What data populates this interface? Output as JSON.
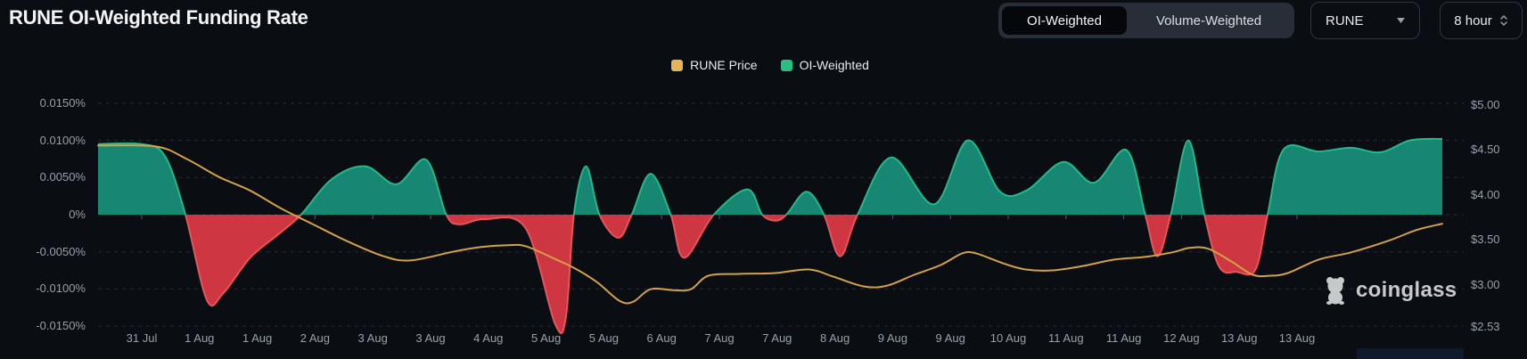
{
  "header": {
    "title": "RUNE OI-Weighted Funding Rate",
    "weighting_toggle": {
      "options": [
        "OI-Weighted",
        "Volume-Weighted"
      ],
      "active": "OI-Weighted"
    },
    "symbol_select": {
      "value": "RUNE"
    },
    "interval_select": {
      "value": "8 hour"
    }
  },
  "legend": [
    {
      "label": "RUNE Price",
      "color": "#E5B455"
    },
    {
      "label": "OI-Weighted",
      "color": "#2CBD84"
    }
  ],
  "watermark": {
    "text": "coinglass"
  },
  "colors": {
    "background": "#0A0D12",
    "grid": "#272C33",
    "axis_text": "#99A0A7",
    "funding_positive_fill": "#178672",
    "funding_positive_edge": "#25B98A",
    "funding_negative_fill": "#CE3642",
    "funding_negative_edge": "#E8545C",
    "price_line": "#D2A148"
  },
  "chart_data": {
    "type": "area",
    "title": "RUNE OI-Weighted Funding Rate",
    "x_unit": "percent_of_plot_width",
    "x_axis": {
      "labels": [
        "31 Jul",
        "1 Aug",
        "1 Aug",
        "2 Aug",
        "3 Aug",
        "3 Aug",
        "4 Aug",
        "5 Aug",
        "5 Aug",
        "6 Aug",
        "7 Aug",
        "7 Aug",
        "8 Aug",
        "9 Aug",
        "9 Aug",
        "10 Aug",
        "11 Aug",
        "11 Aug",
        "12 Aug",
        "13 Aug",
        "13 Aug"
      ]
    },
    "left_axis": {
      "unit": "%",
      "tick_labels": [
        "0.0150%",
        "0.0100%",
        "0.0050%",
        "0%",
        "-0.0050%",
        "-0.0100%",
        "-0.0150%"
      ],
      "tick_values": [
        0.015,
        0.01,
        0.005,
        0,
        -0.005,
        -0.01,
        -0.015
      ],
      "range": [
        -0.0175,
        0.0175
      ]
    },
    "right_axis": {
      "unit": "USD",
      "tick_labels": [
        "$5.00",
        "$4.50",
        "$4.00",
        "$3.50",
        "$3.00",
        "$2.53"
      ],
      "tick_values": [
        5.0,
        4.5,
        4.0,
        3.5,
        3.0,
        2.53
      ],
      "range": [
        2.53,
        5.0
      ]
    },
    "grid": {
      "style": "dashed",
      "lines": "left_axis_ticks"
    },
    "legend_position": "top-center",
    "series": [
      {
        "name": "OI-Weighted",
        "axis": "left",
        "unit": "%",
        "style": "smoothed-area-positive-negative",
        "points": [
          [
            0,
            0.0095
          ],
          [
            3.3,
            0.0095
          ],
          [
            5,
            0.0078
          ],
          [
            6.5,
            0
          ],
          [
            8.1,
            -0.0115
          ],
          [
            9.3,
            -0.0106
          ],
          [
            11.3,
            -0.0058
          ],
          [
            13.3,
            -0.0028
          ],
          [
            15.1,
            0
          ],
          [
            17.4,
            0.0048
          ],
          [
            19.9,
            0.0065
          ],
          [
            22.2,
            0.0041
          ],
          [
            24.4,
            0.0074
          ],
          [
            25.9,
            0
          ],
          [
            26.9,
            -0.0013
          ],
          [
            28.8,
            -0.0006
          ],
          [
            31.8,
            -0.0018
          ],
          [
            34,
            -0.0147
          ],
          [
            34.8,
            -0.0138
          ],
          [
            35.4,
            0
          ],
          [
            36.3,
            0.0065
          ],
          [
            37.3,
            0
          ],
          [
            38.7,
            -0.0031
          ],
          [
            39.7,
            0
          ],
          [
            41.1,
            0.0055
          ],
          [
            42.6,
            0
          ],
          [
            43.6,
            -0.0058
          ],
          [
            45.8,
            0
          ],
          [
            48.3,
            0.0034
          ],
          [
            49.4,
            0
          ],
          [
            50.4,
            -0.0008
          ],
          [
            51.2,
            0
          ],
          [
            52.7,
            0.0031
          ],
          [
            54,
            0
          ],
          [
            55.2,
            -0.0056
          ],
          [
            56.5,
            0
          ],
          [
            59,
            0.0077
          ],
          [
            62.2,
            0.0014
          ],
          [
            64.7,
            0.01
          ],
          [
            67.1,
            0.0031
          ],
          [
            69.1,
            0.0033
          ],
          [
            71.8,
            0.0071
          ],
          [
            74.1,
            0.0043
          ],
          [
            76.5,
            0.0087
          ],
          [
            77.9,
            0
          ],
          [
            78.8,
            -0.0056
          ],
          [
            79.8,
            0
          ],
          [
            81.1,
            0.01
          ],
          [
            82.3,
            0
          ],
          [
            83.4,
            -0.007
          ],
          [
            84.7,
            -0.0077
          ],
          [
            86.1,
            -0.0074
          ],
          [
            87,
            0
          ],
          [
            88.2,
            0.0088
          ],
          [
            90.8,
            0.0085
          ],
          [
            93.2,
            0.009
          ],
          [
            95.4,
            0.0084
          ],
          [
            97.6,
            0.01
          ],
          [
            100,
            0.0102
          ]
        ]
      },
      {
        "name": "RUNE Price",
        "axis": "right",
        "unit": "USD",
        "style": "line",
        "points": [
          [
            0,
            4.55
          ],
          [
            4.3,
            4.54
          ],
          [
            6.6,
            4.4
          ],
          [
            9,
            4.2
          ],
          [
            11.3,
            4.05
          ],
          [
            13.6,
            3.85
          ],
          [
            15.9,
            3.68
          ],
          [
            18.6,
            3.48
          ],
          [
            21.2,
            3.32
          ],
          [
            23.2,
            3.27
          ],
          [
            26.5,
            3.37
          ],
          [
            28.5,
            3.42
          ],
          [
            30.5,
            3.44
          ],
          [
            31.8,
            3.43
          ],
          [
            33.8,
            3.3
          ],
          [
            35.5,
            3.18
          ],
          [
            37.1,
            3.03
          ],
          [
            38.8,
            2.82
          ],
          [
            39.8,
            2.81
          ],
          [
            41.1,
            2.95
          ],
          [
            42.8,
            2.94
          ],
          [
            44.1,
            2.95
          ],
          [
            45.4,
            3.1
          ],
          [
            47.7,
            3.12
          ],
          [
            50.4,
            3.13
          ],
          [
            52.9,
            3.17
          ],
          [
            54.7,
            3.09
          ],
          [
            57,
            2.98
          ],
          [
            58.7,
            2.99
          ],
          [
            60.7,
            3.11
          ],
          [
            62.7,
            3.22
          ],
          [
            64.3,
            3.35
          ],
          [
            65.3,
            3.35
          ],
          [
            67.3,
            3.24
          ],
          [
            69,
            3.17
          ],
          [
            71,
            3.16
          ],
          [
            73.3,
            3.21
          ],
          [
            75.6,
            3.28
          ],
          [
            77.9,
            3.31
          ],
          [
            79.9,
            3.36
          ],
          [
            81.2,
            3.41
          ],
          [
            82.6,
            3.4
          ],
          [
            84.4,
            3.25
          ],
          [
            85.9,
            3.11
          ],
          [
            87.2,
            3.1
          ],
          [
            88.5,
            3.13
          ],
          [
            90.8,
            3.28
          ],
          [
            93.2,
            3.36
          ],
          [
            96,
            3.49
          ],
          [
            98.1,
            3.61
          ],
          [
            100,
            3.68
          ]
        ]
      }
    ]
  }
}
